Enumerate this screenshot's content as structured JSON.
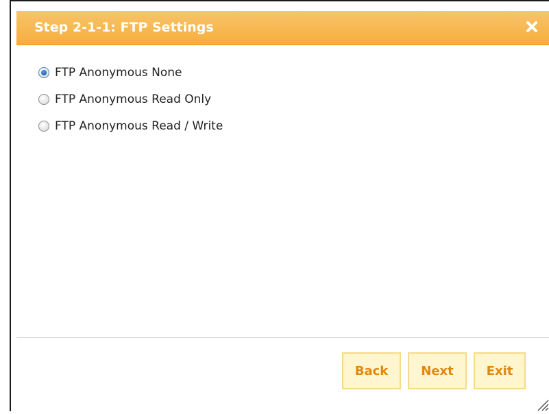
{
  "dialog": {
    "title": "Step 2-1-1: FTP Settings",
    "close_icon": "close-icon",
    "accent_color": "#f5ae3c",
    "options": [
      {
        "label": "FTP Anonymous None",
        "checked": true
      },
      {
        "label": "FTP Anonymous Read Only",
        "checked": false
      },
      {
        "label": "FTP Anonymous Read / Write",
        "checked": false
      }
    ],
    "buttons": {
      "back": "Back",
      "next": "Next",
      "exit": "Exit"
    }
  }
}
